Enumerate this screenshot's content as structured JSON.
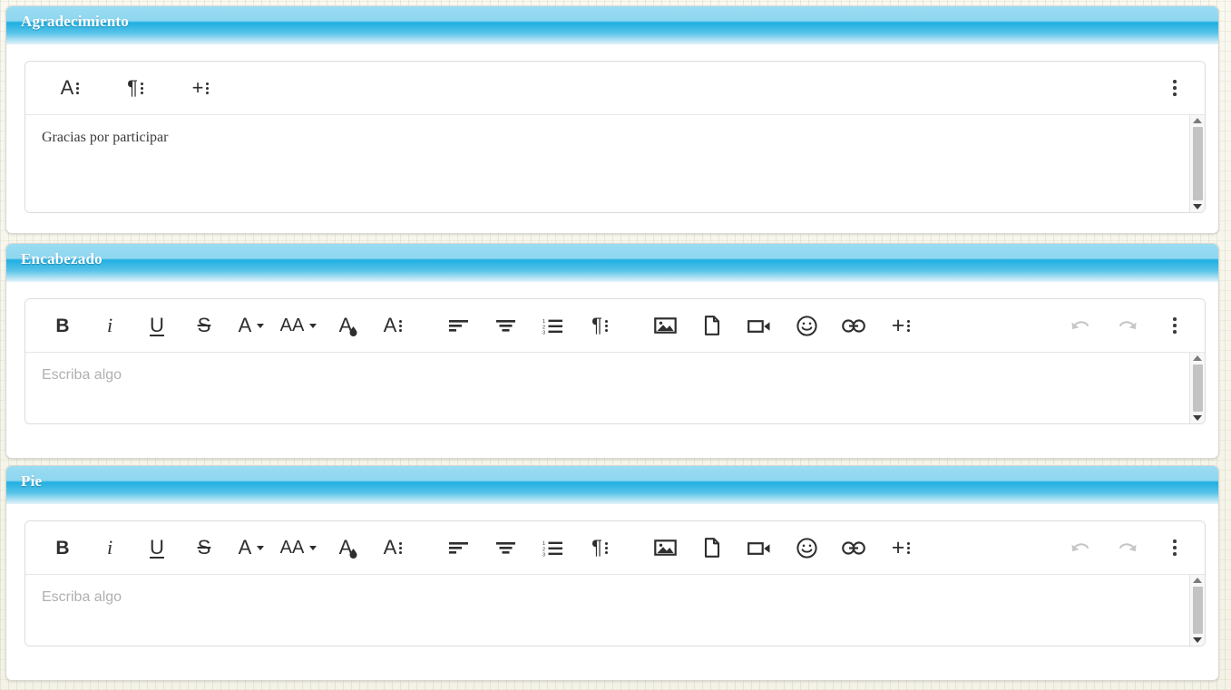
{
  "panels": [
    {
      "id": "agradecimiento",
      "title": "Agradecimiento",
      "editor": {
        "content_text": "Gracias por participar",
        "placeholder": "",
        "toolbar_mode": "collapsed",
        "buttons": [
          {
            "name": "font-style-menu-button",
            "label": "A",
            "icon": "letter-a-with-dots-icon"
          },
          {
            "name": "paragraph-menu-button",
            "label": "¶",
            "icon": "pilcrow-with-dots-icon"
          },
          {
            "name": "insert-menu-button",
            "label": "+",
            "icon": "plus-with-dots-icon"
          },
          {
            "name": "more-options-button",
            "label": "",
            "icon": "vertical-ellipsis-icon"
          }
        ]
      }
    },
    {
      "id": "encabezado",
      "title": "Encabezado",
      "editor": {
        "content_text": "",
        "placeholder": "Escriba algo",
        "toolbar_mode": "full"
      }
    },
    {
      "id": "pie",
      "title": "Pie",
      "editor": {
        "content_text": "",
        "placeholder": "Escriba algo",
        "toolbar_mode": "full"
      }
    }
  ],
  "toolbar_full": {
    "bold": {
      "label": "B",
      "name": "bold-button"
    },
    "italic": {
      "label": "i",
      "name": "italic-button"
    },
    "underline": {
      "label": "U",
      "name": "underline-button"
    },
    "strikethrough": {
      "label": "S",
      "name": "strikethrough-button"
    },
    "font_family": {
      "label": "A",
      "name": "font-family-button"
    },
    "font_size": {
      "label": "AA",
      "name": "font-size-button"
    },
    "text_color": {
      "label": "A",
      "name": "text-color-button"
    },
    "font_style": {
      "label": "A",
      "name": "font-style-button"
    },
    "align_left": {
      "name": "align-left-button"
    },
    "align_center": {
      "name": "align-center-button"
    },
    "ordered_list": {
      "name": "ordered-list-button"
    },
    "paragraph": {
      "label": "¶",
      "name": "paragraph-button"
    },
    "image": {
      "name": "insert-image-button"
    },
    "file": {
      "name": "insert-file-button"
    },
    "video": {
      "name": "insert-video-button"
    },
    "emoji": {
      "name": "insert-emoji-button"
    },
    "link": {
      "name": "insert-link-button"
    },
    "plus": {
      "label": "+",
      "name": "insert-more-button"
    },
    "undo": {
      "name": "undo-button",
      "state": "disabled"
    },
    "redo": {
      "name": "redo-button",
      "state": "disabled"
    },
    "more": {
      "name": "more-options-button"
    }
  },
  "colors": {
    "header_gradient_top": "#9adcf2",
    "header_gradient_mid": "#25b1e2",
    "header_gradient_bottom": "#e4f4fb",
    "panel_background": "#ffffff",
    "page_background": "#f4f2e4",
    "icon": "#2e2e2e",
    "icon_disabled": "#c6c6c6",
    "placeholder_text": "#b0b0b0",
    "content_text": "#3b3b3b"
  }
}
